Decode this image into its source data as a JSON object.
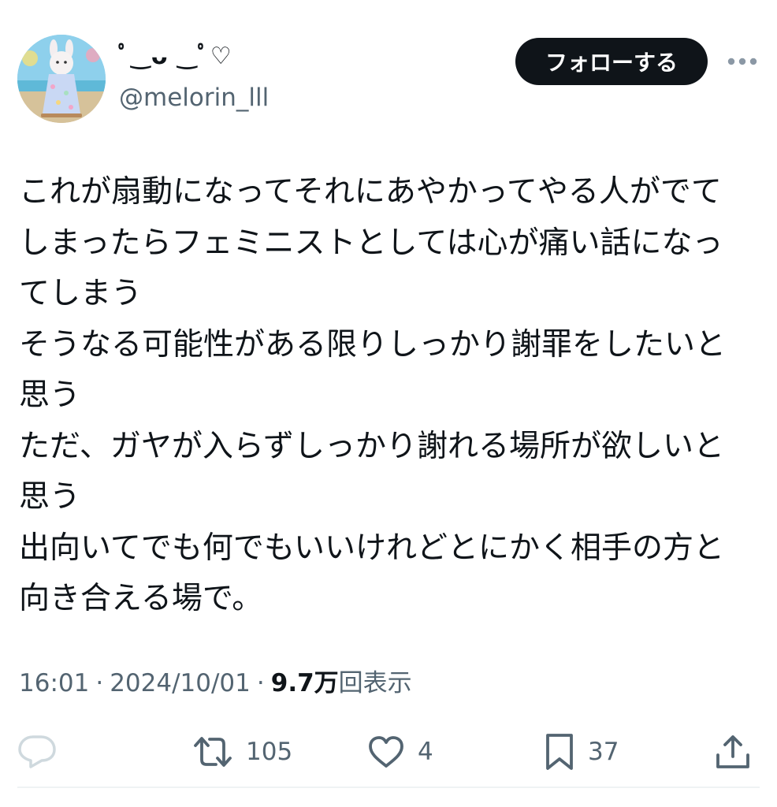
{
  "author": {
    "display_name": "ﾟ‿ᴗ ‿ﾟ♡",
    "handle": "@melorin_lll",
    "avatar_icon": "avatar-rabbit-figure"
  },
  "follow_label": "フォローする",
  "more_icon": "more-dots-icon",
  "tweet": {
    "text": "これが扇動になってそれにあやかってやる人がでてしまったらフェミニストとしては心が痛い話になってしまう\nそうなる可能性がある限りしっかり謝罪をしたいと思う\nただ、ガヤが入らずしっかり謝れる場所が欲しいと思う\n出向いてでも何でもいいけれどとにかく相手の方と向き合える場で。"
  },
  "meta": {
    "time": "16:01",
    "date": "2024/10/01",
    "separator": "·",
    "views_count": "9.7万",
    "views_label": "回表示"
  },
  "actions": {
    "reply_count": "",
    "retweet_count": "105",
    "like_count": "4",
    "bookmark_count": "37"
  },
  "colors": {
    "text": "#0f1419",
    "secondary": "#536471",
    "follow_bg": "#0f1419",
    "divider": "#eff3f4",
    "reply_icon": "#cfd9de"
  }
}
